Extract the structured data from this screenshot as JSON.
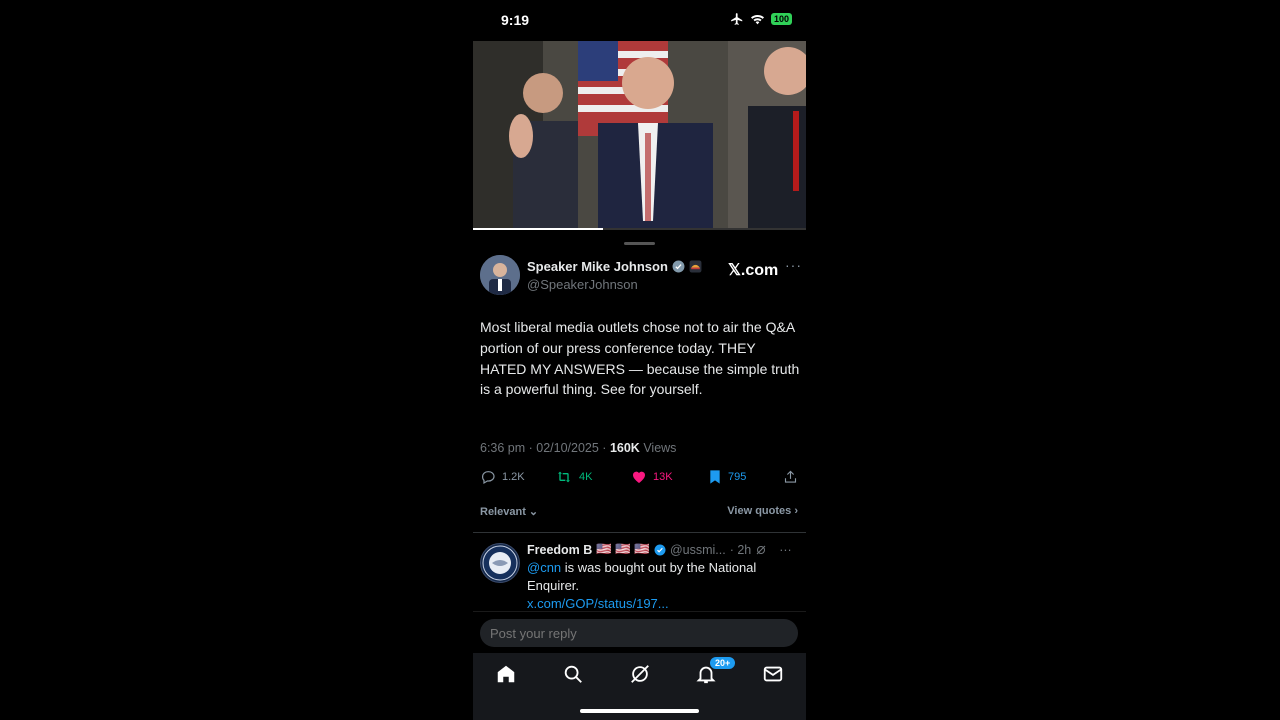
{
  "status": {
    "time": "9:19",
    "battery": "100"
  },
  "video": {
    "progress_pct": 39
  },
  "tweet": {
    "author_name": "Speaker Mike Johnson",
    "author_handle": "@SpeakerJohnson",
    "brand": "𝕏.com",
    "more": "···",
    "text": "Most liberal media outlets chose not to air the Q&A portion of our press conference today. THEY HATED MY ANSWERS — because the simple truth is a powerful thing. See for yourself.",
    "time": "6:36 pm · 02/10/2025 · ",
    "views_count": "160K",
    "views_label": " Views",
    "replies": "1.2K",
    "reposts": "4K",
    "likes": "13K",
    "bookmarks": "795"
  },
  "sort": {
    "label": "Relevant",
    "chevron": "⌄",
    "quotes": "View quotes",
    "quotes_chevron": "›"
  },
  "reply": {
    "name": "Freedom B",
    "flags": "🇺🇸 🇺🇸 🇺🇸",
    "handle": "@ussmi...",
    "age": "· 2h",
    "more": "···",
    "mention": "@cnn",
    "text": " is was bought out by the National Enquirer.",
    "link": "x.com/GOP/status/197..."
  },
  "compose": {
    "placeholder": "Post your reply"
  },
  "tabbar": {
    "notifications_badge": "20+"
  },
  "colors": {
    "accent": "#1d9bf0",
    "repost": "#00ba7c",
    "like": "#f91880",
    "battery": "#30d158"
  },
  "icons": [
    "airplane-icon",
    "wifi-icon",
    "verified-icon",
    "reply-icon",
    "repost-icon",
    "heart-icon",
    "bookmark-icon",
    "share-icon",
    "home-icon",
    "search-icon",
    "grok-icon",
    "bell-icon",
    "mail-icon"
  ]
}
